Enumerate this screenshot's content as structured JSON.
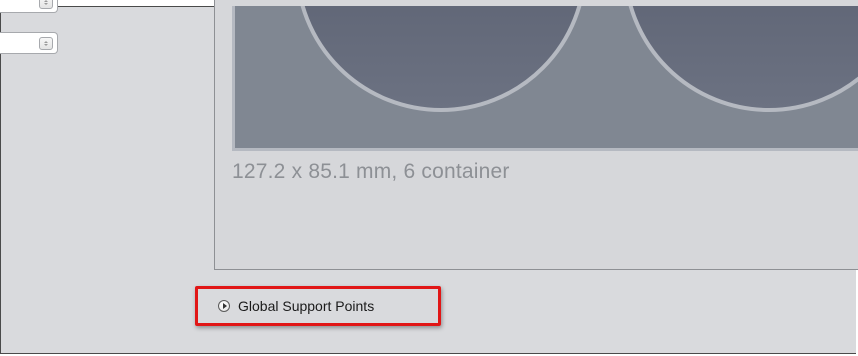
{
  "plate": {
    "caption": "127.2 x 85.1 mm, 6 container",
    "colors": {
      "plate_fill": "#808792",
      "well_fill": "#5f6575",
      "well_rim": "#b5b9c1"
    }
  },
  "expander": {
    "label": "Global Support Points",
    "icon": "expand-right-icon",
    "highlight_color": "#e11616"
  }
}
